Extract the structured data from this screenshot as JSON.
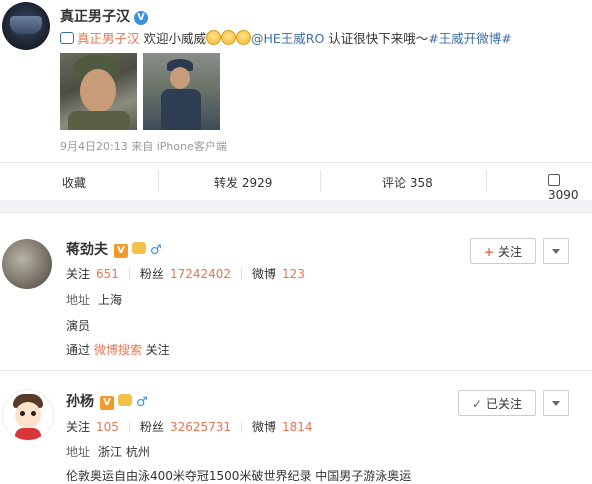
{
  "post": {
    "author": "真正男子汉",
    "verified_badge": "V",
    "retweet_icon": "retweet-icon",
    "text_prefix_link": "真正男子汉",
    "text_welcome": " 欢迎小威威",
    "mention": "@HE王威RO",
    "text_middle": " 认证很快下来哦～",
    "hashtag": "#王威开微博#",
    "meta": "9月4日20:13 来自 iPhone客户端",
    "actions": {
      "favorite": "收藏",
      "repost": "转发 2929",
      "comment": "评论 358",
      "like": "3090"
    }
  },
  "users": [
    {
      "name": "蒋劲夫",
      "v_badge": "V",
      "gender_symbol": "♂",
      "follow_label": "关注",
      "follow_icon": "+",
      "stats": {
        "following_label": "关注",
        "following": "651",
        "fans_label": "粉丝",
        "fans": "17242402",
        "weibo_label": "微博",
        "weibo": "123"
      },
      "location_label": "地址",
      "location": "上海",
      "bio": "演员",
      "via_prefix": "通过",
      "via_link": "微博搜索",
      "via_suffix": " 关注"
    },
    {
      "name": "孙杨",
      "v_badge": "V",
      "gender_symbol": "♂",
      "follow_label": "已关注",
      "follow_icon": "✓",
      "stats": {
        "following_label": "关注",
        "following": "105",
        "fans_label": "粉丝",
        "fans": "32625731",
        "weibo_label": "微博",
        "weibo": "1814"
      },
      "location_label": "地址",
      "location": "浙江 杭州",
      "bio": "伦敦奥运自由泳400米夺冠1500米破世界纪录 中国男子游泳奥运"
    }
  ],
  "colors": {
    "accent": "#eb7350",
    "link_blue": "#3c6da8",
    "vip_orange": "#f29b2b",
    "male_blue": "#3c8fe0"
  }
}
